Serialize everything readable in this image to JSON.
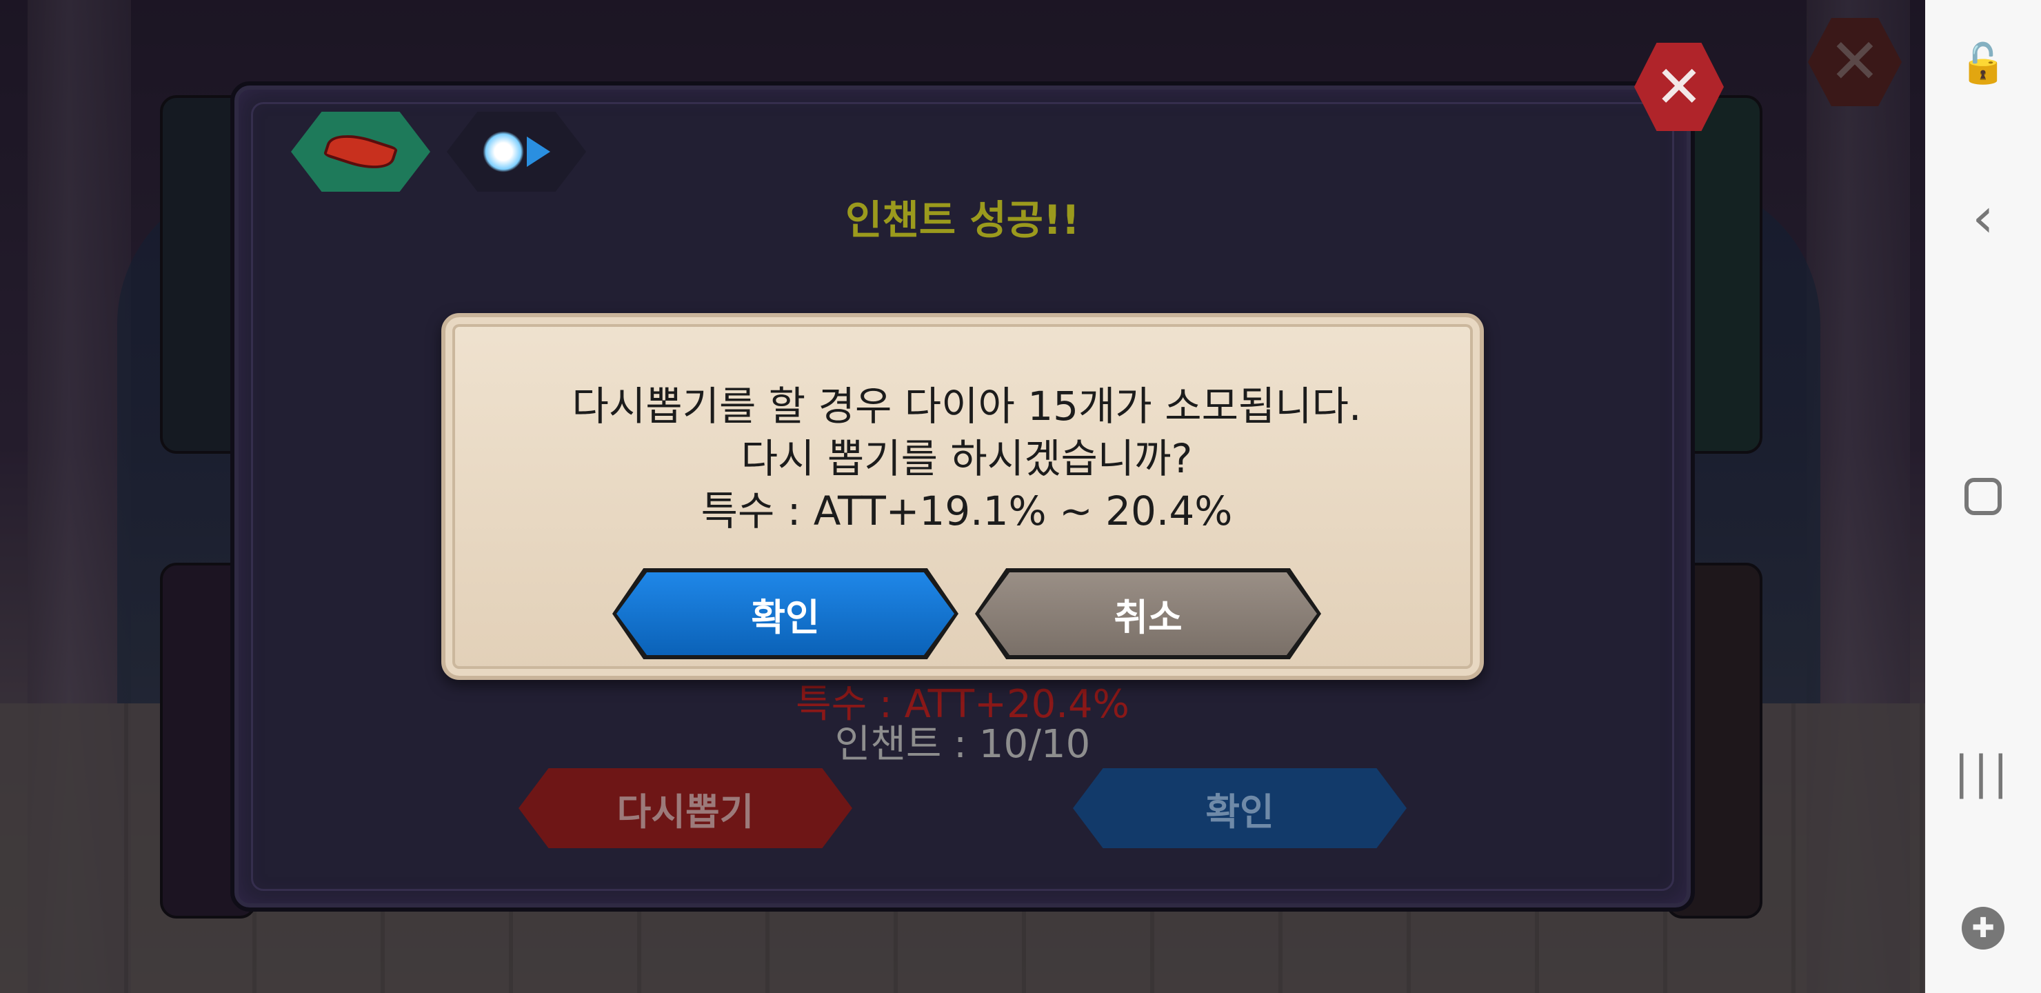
{
  "game": {
    "panel": {
      "title": "인챈트 성공!!",
      "special_stat": "특수 : ATT+20.4%",
      "enchant_count": "인챈트 : 10/10",
      "redraw_button": "다시뽑기",
      "confirm_button": "확인",
      "close_icon": "close-icon",
      "tabs": [
        {
          "icon": "feather-icon"
        },
        {
          "icon": "enchant-burst-icon"
        }
      ]
    },
    "dialog": {
      "line1": "다시뽑기를 할 경우 다이아 15개가 소모됩니다.",
      "line2": "다시 뽑기를 하시겠습니까?",
      "line3": "특수 : ATT+19.1% ~ 20.4%",
      "ok_button": "확인",
      "cancel_button": "취소"
    },
    "colors": {
      "title": "#9b9a1d",
      "ok_button": "#1f87e8",
      "cancel_button": "#8a8078",
      "redraw_button": "#6e1616",
      "close_button": "#b0242a"
    }
  },
  "navbar": {
    "icons": [
      "touch-lock-icon",
      "back-icon",
      "home-icon",
      "recent-apps-icon",
      "game-tools-icon"
    ]
  }
}
